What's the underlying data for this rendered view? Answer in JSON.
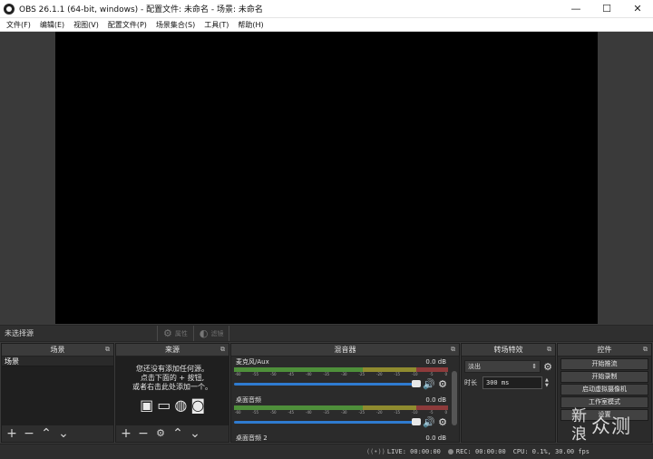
{
  "window": {
    "title": "OBS 26.1.1 (64-bit, windows) - 配置文件: 未命名 - 场景: 未命名",
    "minimize": "—",
    "maximize": "☐",
    "close": "✕"
  },
  "menu": [
    "文件(F)",
    "编辑(E)",
    "视图(V)",
    "配置文件(P)",
    "场景集合(S)",
    "工具(T)",
    "帮助(H)"
  ],
  "source_toolbar": {
    "no_selection": "未选择源",
    "properties": "属性",
    "filters": "滤镜"
  },
  "docks": {
    "scenes": {
      "title": "场景",
      "items": [
        "场景"
      ]
    },
    "sources": {
      "title": "来源",
      "hint_line1": "您还没有添加任何源。",
      "hint_line2": "点击下面的 + 按钮,",
      "hint_line3": "或者右击此处添加一个。"
    },
    "mixer": {
      "title": "混音器",
      "channels": [
        {
          "name": "麦克风/Aux",
          "db": "0.0 dB",
          "level": 0.0
        },
        {
          "name": "桌面音频",
          "db": "0.0 dB",
          "level": 0.0
        },
        {
          "name": "桌面音频 2",
          "db": "0.0 dB",
          "level": 0.0
        }
      ],
      "ticks": [
        "-60",
        "-55",
        "-50",
        "-45",
        "-40",
        "-35",
        "-30",
        "-25",
        "-20",
        "-15",
        "-10",
        "-5",
        "0"
      ]
    },
    "transitions": {
      "title": "转场特效",
      "selected": "淡出",
      "duration_label": "时长",
      "duration_value": "300 ms"
    },
    "controls": {
      "title": "控件",
      "buttons": [
        "开始推流",
        "开始录制",
        "启动虚拟摄像机",
        "工作室模式",
        "设置"
      ]
    }
  },
  "status": {
    "live": "LIVE: 00:00:00",
    "rec": "REC: 00:00:00",
    "cpu": "CPU: 0.1%, 30.00 fps"
  },
  "watermark": {
    "line1": "新",
    "line2": "浪",
    "big": "众测"
  }
}
